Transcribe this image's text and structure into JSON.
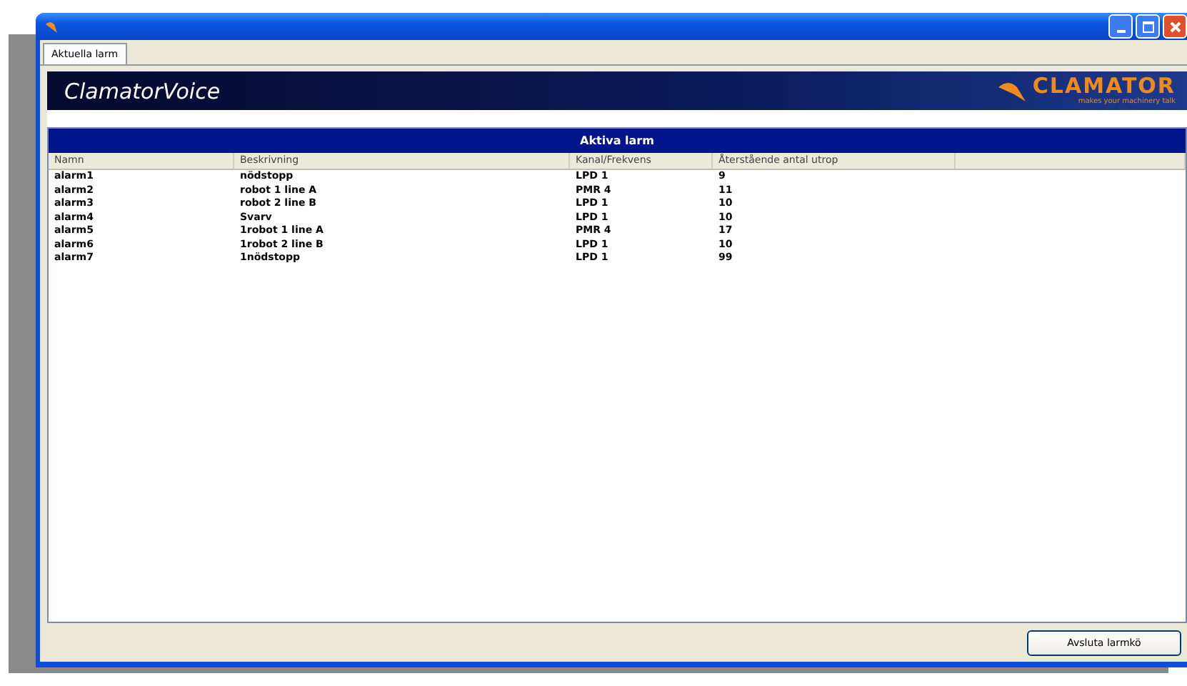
{
  "tabs": [
    {
      "label": "Aktuella larm",
      "selected": true
    }
  ],
  "banner": {
    "title": "ClamatorVoice",
    "logo": "CLAMATOR",
    "tagline": "makes your machinery talk"
  },
  "panel": {
    "title": "Aktiva larm"
  },
  "table": {
    "columns": [
      "Namn",
      "Beskrivning",
      "Kanal/Frekvens",
      "Återstående antal utrop"
    ],
    "rows": [
      [
        "alarm1",
        "nödstopp",
        "LPD 1",
        "9"
      ],
      [
        "alarm2",
        "robot 1 line A",
        "PMR 4",
        "11"
      ],
      [
        "alarm3",
        "robot 2 line B",
        "LPD 1",
        "10"
      ],
      [
        "alarm4",
        "Svarv",
        "LPD 1",
        "10"
      ],
      [
        "alarm5",
        "1robot 1 line A",
        "PMR 4",
        "17"
      ],
      [
        "alarm6",
        "1robot 2 line B",
        "LPD 1",
        "10"
      ],
      [
        "alarm7",
        "1nödstopp",
        "LPD 1",
        "99"
      ]
    ]
  },
  "buttons": [
    "Avsluta larmkö"
  ]
}
